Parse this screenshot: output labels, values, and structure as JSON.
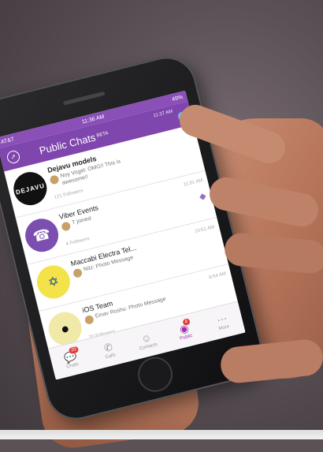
{
  "status": {
    "carrier": "AT&T",
    "time": "11:36 AM",
    "battery": "49%"
  },
  "nav": {
    "title": "Public Chats",
    "beta": "BETA",
    "time": "11:37 AM",
    "badge": "1"
  },
  "chats": [
    {
      "title": "Dejavu models",
      "avatar_text": "DEJAVU",
      "time": "",
      "message": "Noy Vogel: OMG!! This is awesome!!",
      "followers": "121 Followers"
    },
    {
      "title": "Viber Events",
      "avatar_text": "☎",
      "time": "11:01 AM",
      "message": "T joined",
      "followers": "4 Followers"
    },
    {
      "title": "Maccabi Electra Tel...",
      "avatar_text": "✡",
      "time": "10:51 AM",
      "message": "Nitz: Photo Message",
      "followers": ""
    },
    {
      "title": "iOS Team",
      "avatar_text": "",
      "time": "8:54 AM",
      "message": "Einav Roshu: Photo Message",
      "followers": "20 Followers"
    }
  ],
  "tabs": [
    {
      "label": "Chats",
      "icon": "chat-bubble-icon",
      "badge": "20"
    },
    {
      "label": "Calls",
      "icon": "phone-icon",
      "badge": ""
    },
    {
      "label": "Contacts",
      "icon": "person-icon",
      "badge": ""
    },
    {
      "label": "Public",
      "icon": "public-chats-icon",
      "badge": "4"
    },
    {
      "label": "More",
      "icon": "more-icon",
      "badge": ""
    }
  ],
  "colors": {
    "accent": "#7f46ad",
    "badge": "#e23b3b"
  }
}
